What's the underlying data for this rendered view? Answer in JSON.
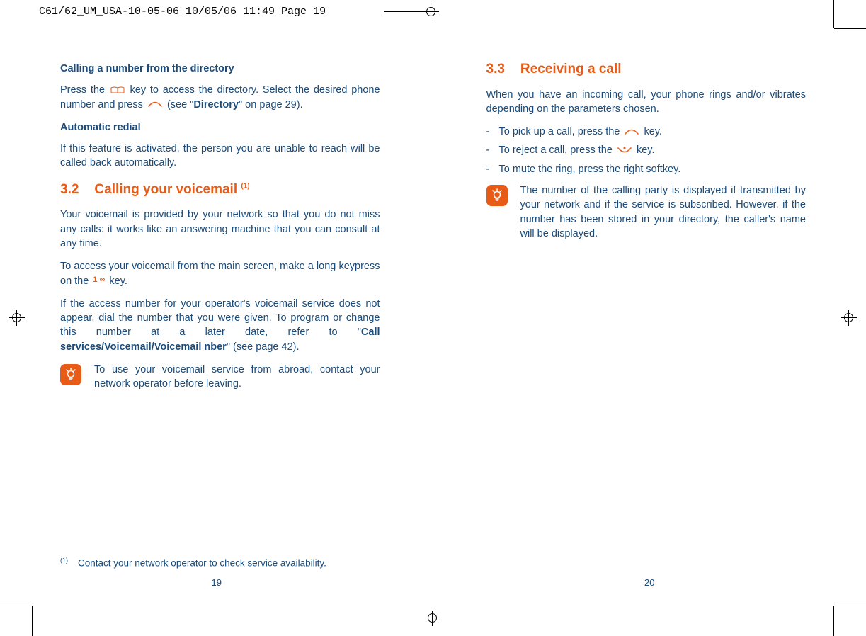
{
  "print_header": "C61/62_UM_USA-10-05-06  10/05/06  11:49  Page 19",
  "left": {
    "h_directory": "Calling a number from the directory",
    "p_directory_1a": "Press the ",
    "p_directory_1b": " key to access the directory. Select the desired phone number and press ",
    "p_directory_1c": " (see \"",
    "p_directory_bold": "Directory",
    "p_directory_1d": "\" on page 29).",
    "h_redial": "Automatic redial",
    "p_redial": "If this feature is activated, the person you are unable to reach will be called back automatically.",
    "sec32_num": "3.2",
    "sec32_title": "Calling your voicemail ",
    "sec32_sup": "(1)",
    "p_vm1": "Your voicemail is provided by your network so that you do not miss any calls: it works like an answering machine that you can consult at any time.",
    "p_vm2a": "To access your voicemail from the main screen, make a long keypress on the ",
    "p_vm2b": " key.",
    "key1_label": "1 ∞",
    "p_vm3a": "If the access number for your operator's voicemail service does not appear, dial the number that you were given. To program or change this number at a later date, refer to \"",
    "p_vm3bold": "Call services/Voicemail/Voicemail nber",
    "p_vm3b": "\" (see page 42).",
    "tip": "To use your voicemail service from abroad, contact your network operator before leaving.",
    "footnote_sup": "(1)",
    "footnote": "Contact your network operator to check service availability.",
    "pagenum": "19"
  },
  "right": {
    "sec33_num": "3.3",
    "sec33_title": "Receiving a call",
    "p_intro": "When you have an incoming call, your phone rings and/or vibrates depending on the parameters chosen.",
    "li1a": "To pick up a call, press the ",
    "li1b": " key.",
    "li2a": "To reject a call, press the ",
    "li2b": " key.",
    "li3": "To mute the ring, press the right softkey.",
    "tip": "The number of the calling party is displayed if transmitted by your network and if the service is subscribed. However, if the number has been stored in your directory, the caller's name will be displayed.",
    "pagenum": "20"
  }
}
